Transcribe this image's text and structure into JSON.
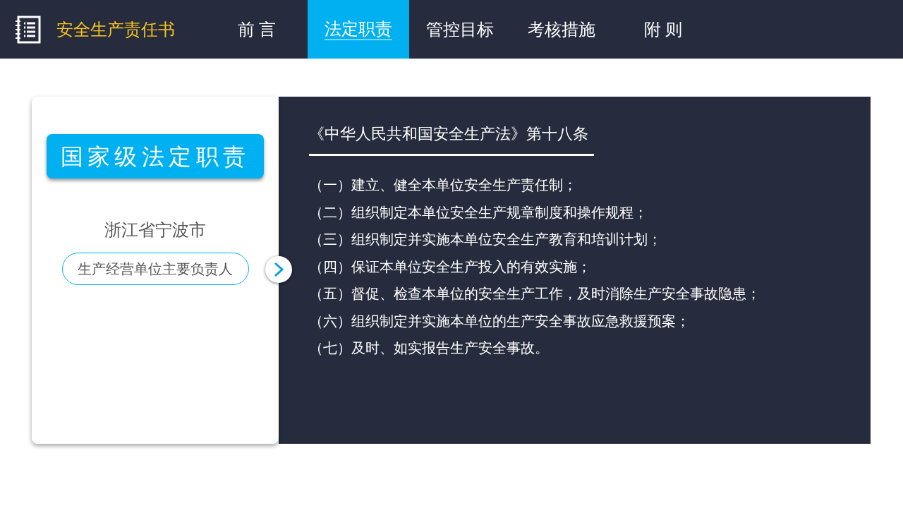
{
  "header": {
    "title": "安全生产责任书"
  },
  "tabs": [
    {
      "label": "前 言",
      "selected": false
    },
    {
      "label": "法定职责",
      "selected": true
    },
    {
      "label": "管控目标",
      "selected": false
    },
    {
      "label": "考核措施",
      "selected": false
    },
    {
      "label": "附 则",
      "selected": false
    }
  ],
  "card": {
    "heading": "国家级法定职责",
    "region": "浙江省宁波市",
    "role": "生产经营单位主要负责人"
  },
  "panel": {
    "title": "《中华人民共和国安全生产法》第十八条",
    "items": [
      "（一）建立、健全本单位安全生产责任制；",
      "（二）组织制定本单位安全生产规章制度和操作规程；",
      "（三）组织制定并实施本单位安全生产教育和培训计划；",
      "（四）保证本单位安全生产投入的有效实施；",
      "（五）督促、检查本单位的安全生产工作，及时消除生产安全事故隐患；",
      "（六）组织制定并实施本单位的生产安全事故应急救援预案；",
      "（七）及时、如实报告生产安全事故。"
    ]
  }
}
